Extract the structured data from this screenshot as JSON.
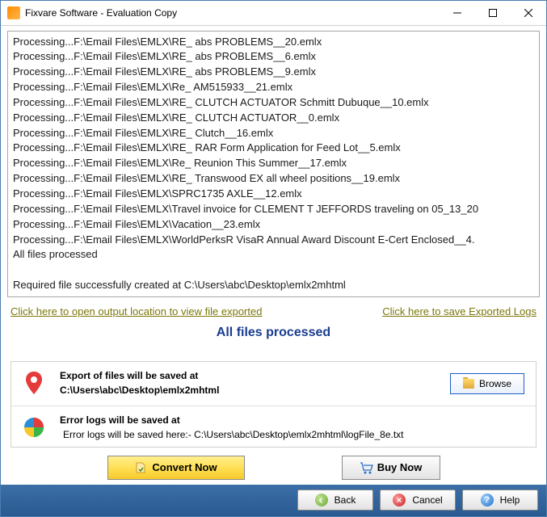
{
  "titlebar": {
    "title": "Fixvare Software - Evaluation Copy"
  },
  "log": {
    "lines": [
      "Processing...F:\\Email Files\\EMLX\\RE_ abs PROBLEMS__20.emlx",
      "Processing...F:\\Email Files\\EMLX\\RE_ abs PROBLEMS__6.emlx",
      "Processing...F:\\Email Files\\EMLX\\RE_ abs PROBLEMS__9.emlx",
      "Processing...F:\\Email Files\\EMLX\\Re_ AM515933__21.emlx",
      "Processing...F:\\Email Files\\EMLX\\RE_ CLUTCH ACTUATOR Schmitt Dubuque__10.emlx",
      "Processing...F:\\Email Files\\EMLX\\RE_ CLUTCH ACTUATOR__0.emlx",
      "Processing...F:\\Email Files\\EMLX\\RE_ Clutch__16.emlx",
      "Processing...F:\\Email Files\\EMLX\\RE_ RAR Form Application for Feed Lot__5.emlx",
      "Processing...F:\\Email Files\\EMLX\\Re_ Reunion This Summer__17.emlx",
      "Processing...F:\\Email Files\\EMLX\\RE_ Transwood EX all wheel positions__19.emlx",
      "Processing...F:\\Email Files\\EMLX\\SPRC1735 AXLE__12.emlx",
      "Processing...F:\\Email Files\\EMLX\\Travel invoice for CLEMENT T JEFFORDS traveling on 05_13_20",
      "Processing...F:\\Email Files\\EMLX\\Vacation__23.emlx",
      "Processing...F:\\Email Files\\EMLX\\WorldPerksR VisaR Annual Award Discount E-Cert Enclosed__4.",
      "All files processed",
      "",
      "Required file successfully created at C:\\Users\\abc\\Desktop\\emlx2mhtml"
    ]
  },
  "links": {
    "open_output": "Click here to open output location to view file exported",
    "save_logs": "Click here to save Exported Logs"
  },
  "status": "All files processed",
  "panels": {
    "export": {
      "label": "Export of files will be saved at",
      "path": "C:\\Users\\abc\\Desktop\\emlx2mhtml",
      "browse": "Browse"
    },
    "error": {
      "label": "Error logs will be saved at",
      "path": "Error logs will be saved here:- C:\\Users\\abc\\Desktop\\emlx2mhtml\\logFile_8e.txt"
    }
  },
  "actions": {
    "convert": "Convert Now",
    "buy": "Buy Now"
  },
  "footer": {
    "back": "Back",
    "cancel": "Cancel",
    "help": "Help"
  }
}
